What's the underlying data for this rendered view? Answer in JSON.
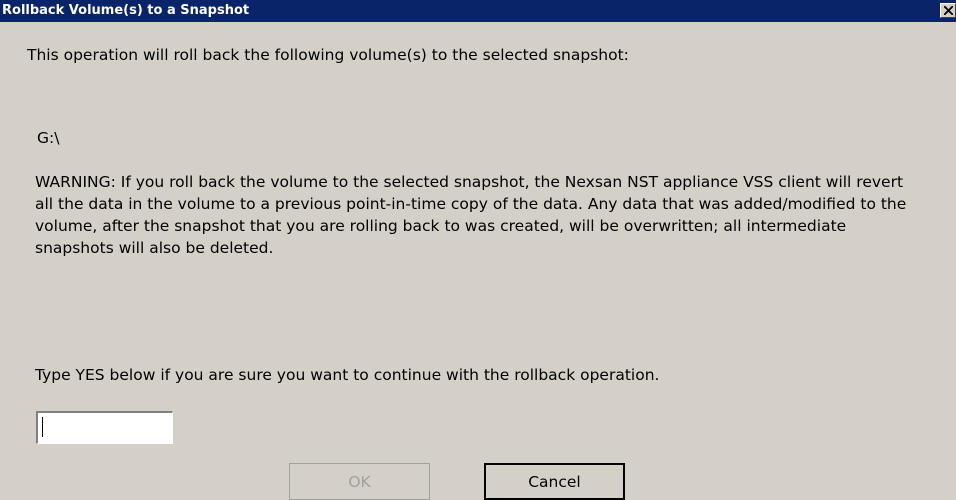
{
  "window": {
    "title": "Rollback Volume(s) to a Snapshot",
    "close_icon": "close-icon"
  },
  "content": {
    "intro": "This operation will roll back the following volume(s) to the selected snapshot:",
    "volume": "G:\\",
    "warning": "WARNING: If you roll back the volume to the selected snapshot, the Nexsan NST appliance VSS client will revert all the data in the volume to a previous point-in-time copy of the data. Any data that was added/modified to the volume, after the snapshot that you are rolling back to was created, will be overwritten;  all intermediate snapshots will also be deleted.",
    "prompt": "Type YES below if you are sure you want to continue with the rollback operation."
  },
  "confirm_input": {
    "value": ""
  },
  "buttons": {
    "ok_label": "OK",
    "ok_enabled": false,
    "cancel_label": "Cancel"
  },
  "colors": {
    "titlebar": "#0a246a",
    "dialog_bg": "#d4d0c8",
    "disabled_text": "#a0a0a0"
  }
}
